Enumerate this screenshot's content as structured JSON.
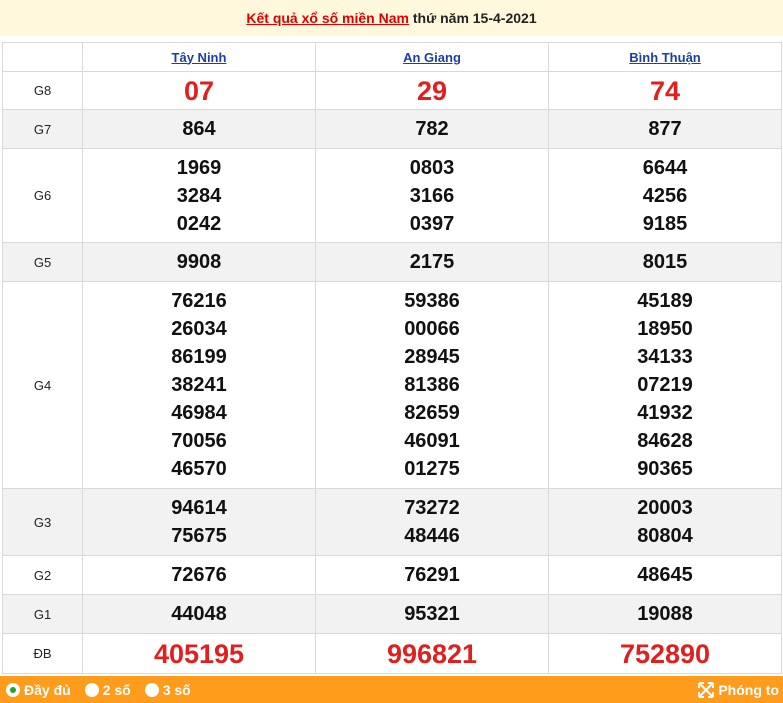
{
  "header": {
    "title_link": "Kết quả xổ số miền Nam",
    "title_rest": " thứ năm 15-4-2021"
  },
  "provinces": [
    "Tây Ninh",
    "An Giang",
    "Bình Thuận"
  ],
  "prizes": [
    {
      "label": "G8",
      "values": [
        [
          "07"
        ],
        [
          "29"
        ],
        [
          "74"
        ]
      ]
    },
    {
      "label": "G7",
      "values": [
        [
          "864"
        ],
        [
          "782"
        ],
        [
          "877"
        ]
      ]
    },
    {
      "label": "G6",
      "values": [
        [
          "1969",
          "3284",
          "0242"
        ],
        [
          "0803",
          "3166",
          "0397"
        ],
        [
          "6644",
          "4256",
          "9185"
        ]
      ]
    },
    {
      "label": "G5",
      "values": [
        [
          "9908"
        ],
        [
          "2175"
        ],
        [
          "8015"
        ]
      ]
    },
    {
      "label": "G4",
      "values": [
        [
          "76216",
          "26034",
          "86199",
          "38241",
          "46984",
          "70056",
          "46570"
        ],
        [
          "59386",
          "00066",
          "28945",
          "81386",
          "82659",
          "46091",
          "01275"
        ],
        [
          "45189",
          "18950",
          "34133",
          "07219",
          "41932",
          "84628",
          "90365"
        ]
      ]
    },
    {
      "label": "G3",
      "values": [
        [
          "94614",
          "75675"
        ],
        [
          "73272",
          "48446"
        ],
        [
          "20003",
          "80804"
        ]
      ]
    },
    {
      "label": "G2",
      "values": [
        [
          "72676"
        ],
        [
          "76291"
        ],
        [
          "48645"
        ]
      ]
    },
    {
      "label": "G1",
      "values": [
        [
          "44048"
        ],
        [
          "95321"
        ],
        [
          "19088"
        ]
      ]
    },
    {
      "label": "ĐB",
      "values": [
        [
          "405195"
        ],
        [
          "996821"
        ],
        [
          "752890"
        ]
      ]
    }
  ],
  "footer": {
    "opt_full": "Đầy đủ",
    "opt_2": "2 số",
    "opt_3": "3 số",
    "zoom": "Phóng to"
  },
  "colors": {
    "accent": "#e02020",
    "footer": "#ff9c1c",
    "link": "#1a3fa8"
  }
}
